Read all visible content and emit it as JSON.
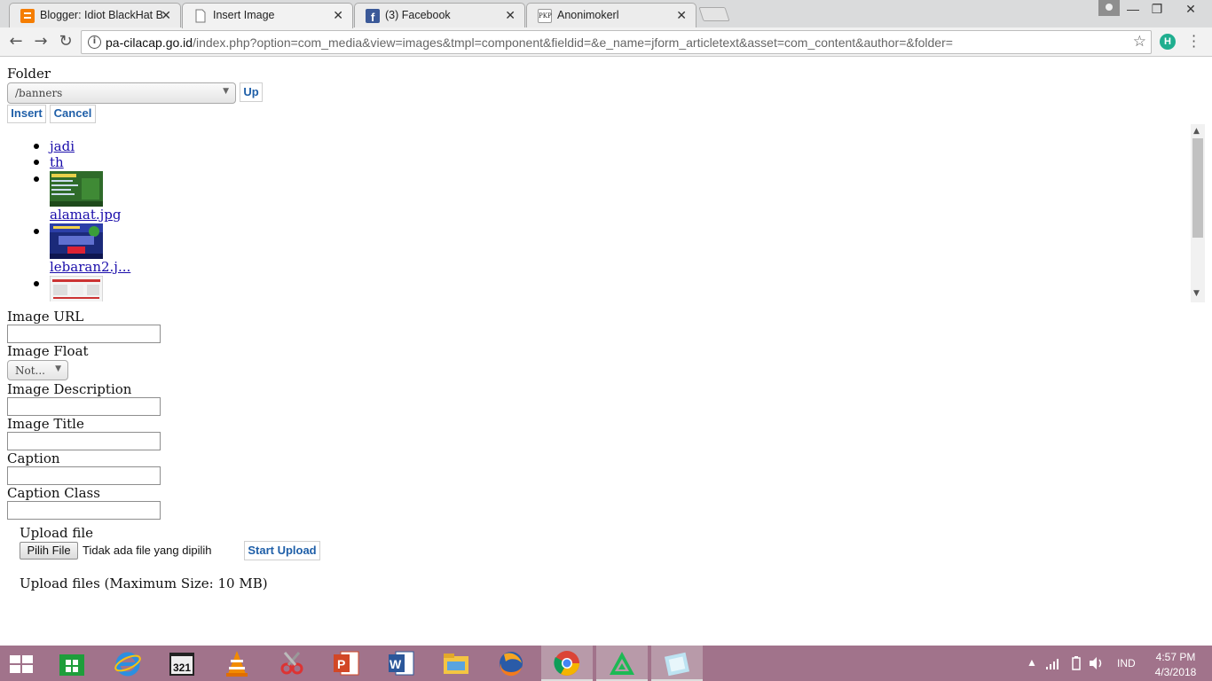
{
  "browser": {
    "tabs": [
      {
        "title": "Blogger: Idiot BlackHat B",
        "favicon": "blogger-icon",
        "active": false
      },
      {
        "title": "Insert Image",
        "favicon": "page-icon",
        "active": true
      },
      {
        "title": "(3) Facebook",
        "favicon": "facebook-icon",
        "active": false
      },
      {
        "title": "Anonimokerl",
        "favicon": "pkp-icon",
        "favicon_text": "PKP",
        "active": false
      }
    ],
    "url_host": "pa-cilacap.go.id",
    "url_path": "/index.php?option=com_media&view=images&tmpl=component&fieldid=&e_name=jform_articletext&asset=com_content&author=&folder=",
    "extension_badge": "H"
  },
  "form": {
    "folder_label": "Folder",
    "folder_value": "/banners",
    "up_button": "Up",
    "insert_button": "Insert",
    "cancel_button": "Cancel",
    "items": [
      {
        "name": "jadi",
        "kind": "folder"
      },
      {
        "name": "th",
        "kind": "folder"
      },
      {
        "name": "alamat.jpg",
        "kind": "image"
      },
      {
        "name": "lebaran2.j...",
        "kind": "image"
      }
    ],
    "image_url_label": "Image URL",
    "image_float_label": "Image Float",
    "image_float_value": "Not...",
    "image_description_label": "Image Description",
    "image_title_label": "Image Title",
    "caption_label": "Caption",
    "caption_class_label": "Caption Class",
    "upload_file_label": "Upload file",
    "choose_file_button": "Pilih File",
    "no_file_text": "Tidak ada file yang dipilih",
    "start_upload_button": "Start Upload",
    "upload_limit_text": "Upload files (Maximum Size: 10 MB)"
  },
  "taskbar": {
    "apps": [
      "start-icon",
      "store-icon",
      "internet-explorer-icon",
      "media-player-classic-icon",
      "vlc-icon",
      "snipping-tool-icon",
      "powerpoint-icon",
      "word-icon",
      "file-explorer-icon",
      "firefox-icon",
      "chrome-icon",
      "green-app-icon",
      "notepad-icon"
    ],
    "language": "IND",
    "time": "4:57 PM",
    "date": "4/3/2018"
  }
}
